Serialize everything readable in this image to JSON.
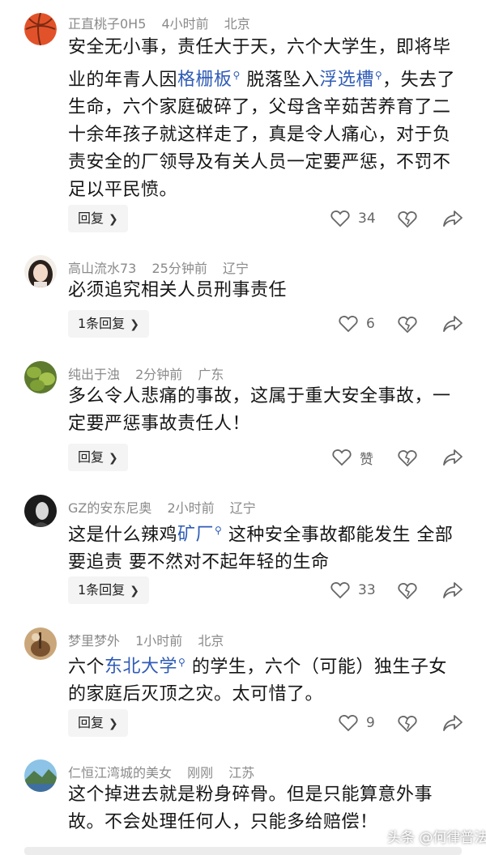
{
  "comments": [
    {
      "user": "正直桃子0H5",
      "time": "4小时前",
      "location": "北京",
      "text_parts": [
        {
          "t": "安全无小事，责任大于天，六个大学生，即将毕业的年青人因"
        },
        {
          "t": "格栅板",
          "link": true
        },
        {
          "t": "脱落坠入"
        },
        {
          "t": "浮选槽",
          "link": true
        },
        {
          "t": "，失去了生命，六个家庭破碎了，父母含辛茹苦养育了二十余年孩子就这样走了，真是令人痛心，对于负责安全的厂领导及有关人员一定要严惩，不罚不足以平民愤。"
        }
      ],
      "reply_label": "回复",
      "likes": "34"
    },
    {
      "user": "高山流水73",
      "time": "25分钟前",
      "location": "辽宁",
      "text_parts": [
        {
          "t": "必须追究相关人员刑事责任"
        }
      ],
      "reply_label": "1条回复",
      "likes": "6"
    },
    {
      "user": "纯出于浊",
      "time": "2分钟前",
      "location": "广东",
      "text_parts": [
        {
          "t": "多么令人悲痛的事故，这属于重大安全事故，一定要严惩事故责任人！"
        }
      ],
      "reply_label": "回复",
      "likes": "赞"
    },
    {
      "user": "GZ的安东尼奥",
      "time": "2小时前",
      "location": "辽宁",
      "text_parts": [
        {
          "t": "这是什么辣鸡"
        },
        {
          "t": "矿厂",
          "link": true
        },
        {
          "t": " 这种安全事故都能发生 全部要追责 要不然对不起年轻的生命"
        }
      ],
      "reply_label": "1条回复",
      "likes": "33"
    },
    {
      "user": "梦里梦外",
      "time": "1小时前",
      "location": "北京",
      "text_parts": [
        {
          "t": "六个"
        },
        {
          "t": "东北大学",
          "link": true
        },
        {
          "t": " 的学生，六个（可能）独生子女的家庭后灭顶之灾。太可惜了。"
        }
      ],
      "reply_label": "回复",
      "likes": "9"
    },
    {
      "user": "仁恒江湾城的美女",
      "time": "刚刚",
      "location": "江苏",
      "text_parts": [
        {
          "t": "这个掉进去就是粉身碎骨。但是只能算意外事故。不会处理任何人，只能多给赔偿！"
        }
      ]
    }
  ],
  "watermark": "头条 @何律普法",
  "colors": {
    "link": "#2f5bb7",
    "meta": "#8a8a8a",
    "reply_bg": "#f4f4f4"
  }
}
